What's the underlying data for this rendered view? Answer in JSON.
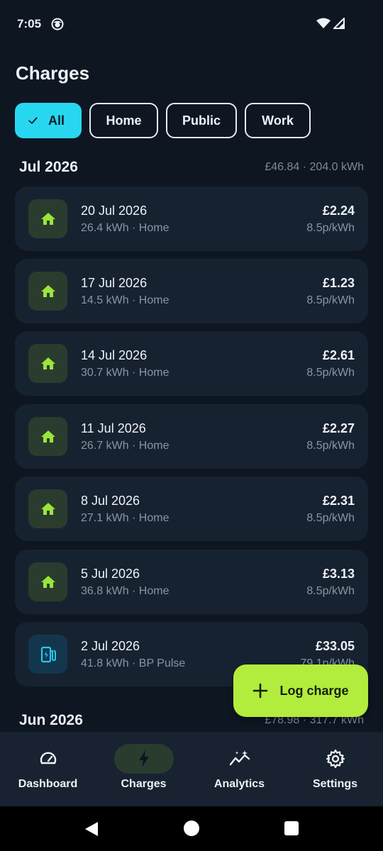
{
  "status_bar": {
    "time": "7:05"
  },
  "header": {
    "title": "Charges"
  },
  "filters": [
    {
      "label": "All",
      "selected": true
    },
    {
      "label": "Home",
      "selected": false
    },
    {
      "label": "Public",
      "selected": false
    },
    {
      "label": "Work",
      "selected": false
    }
  ],
  "months": [
    {
      "label": "Jul 2026",
      "summary": "£46.84 · 204.0 kWh"
    },
    {
      "label": "Jun 2026",
      "summary": "£78.98 · 317.7 kWh"
    }
  ],
  "charges": [
    {
      "date": "20 Jul 2026",
      "details": "26.4 kWh · Home",
      "cost": "£2.24",
      "rate": "8.5p/kWh",
      "icon": "home-icon",
      "kind": "home"
    },
    {
      "date": "17 Jul 2026",
      "details": "14.5 kWh · Home",
      "cost": "£1.23",
      "rate": "8.5p/kWh",
      "icon": "home-icon",
      "kind": "home"
    },
    {
      "date": "14 Jul 2026",
      "details": "30.7 kWh · Home",
      "cost": "£2.61",
      "rate": "8.5p/kWh",
      "icon": "home-icon",
      "kind": "home"
    },
    {
      "date": "11 Jul 2026",
      "details": "26.7 kWh · Home",
      "cost": "£2.27",
      "rate": "8.5p/kWh",
      "icon": "home-icon",
      "kind": "home"
    },
    {
      "date": "8 Jul 2026",
      "details": "27.1 kWh · Home",
      "cost": "£2.31",
      "rate": "8.5p/kWh",
      "icon": "home-icon",
      "kind": "home"
    },
    {
      "date": "5 Jul 2026",
      "details": "36.8 kWh · Home",
      "cost": "£3.13",
      "rate": "8.5p/kWh",
      "icon": "home-icon",
      "kind": "home"
    },
    {
      "date": "2 Jul 2026",
      "details": "41.8 kWh · BP Pulse",
      "cost": "£33.05",
      "rate": "79.1p/kWh",
      "icon": "ev-station-icon",
      "kind": "public"
    }
  ],
  "fab": {
    "label": "Log charge",
    "icon": "plus-icon"
  },
  "bottom_nav": [
    {
      "label": "Dashboard",
      "icon": "speedometer-icon",
      "active": false
    },
    {
      "label": "Charges",
      "icon": "bolt-icon",
      "active": true
    },
    {
      "label": "Analytics",
      "icon": "analytics-icon",
      "active": false
    },
    {
      "label": "Settings",
      "icon": "gear-icon",
      "active": false
    }
  ],
  "colors": {
    "background": "#0e1622",
    "card": "#172231",
    "accent_cyan": "#27d7ef",
    "accent_green": "#b2ec3c",
    "home_icon": "#9be53a",
    "public_icon": "#2ec5f0"
  }
}
